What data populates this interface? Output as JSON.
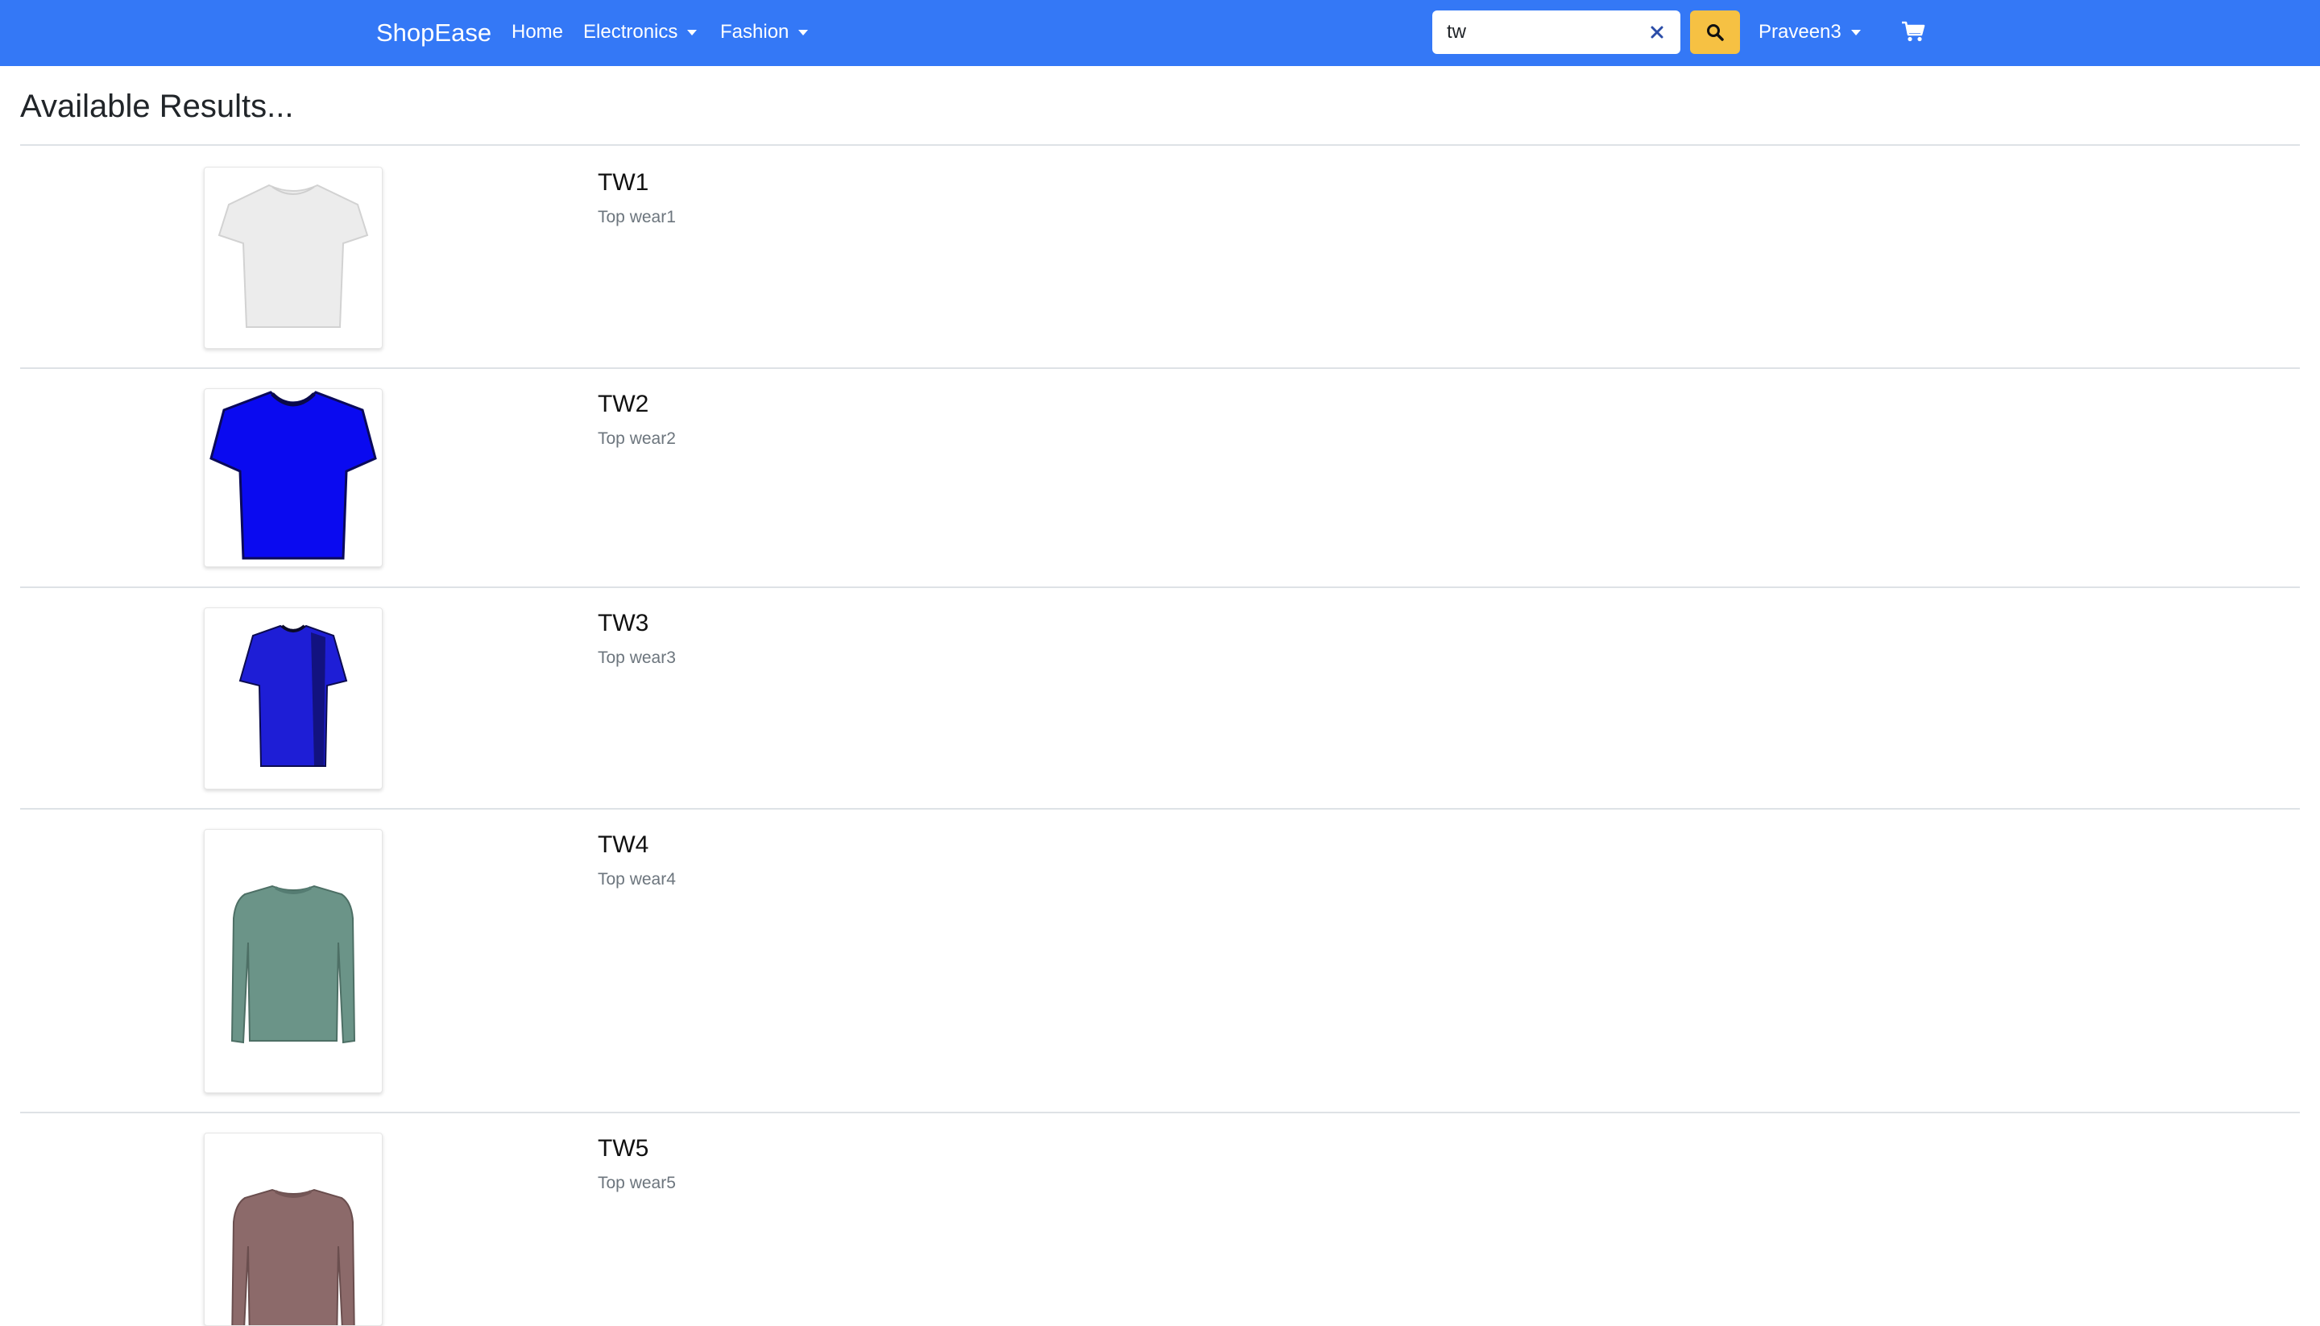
{
  "navbar": {
    "brand": "ShopEase",
    "links": [
      {
        "label": "Home",
        "dropdown": false
      },
      {
        "label": "Electronics",
        "dropdown": true
      },
      {
        "label": "Fashion",
        "dropdown": true
      }
    ],
    "search": {
      "value": "tw"
    },
    "user": {
      "label": "Praveen3"
    },
    "icons": {
      "clear": "close-icon",
      "search": "search-icon",
      "cart": "cart-icon"
    },
    "colors": {
      "navbar": "#3478f6",
      "search_button": "#f6c143"
    }
  },
  "page": {
    "heading": "Available Results..."
  },
  "results": [
    {
      "title": "TW1",
      "description": "Top wear1",
      "image": "white t-shirt",
      "color": "#ececec"
    },
    {
      "title": "TW2",
      "description": "Top wear2",
      "image": "blue t-shirt",
      "color": "#0a0af0"
    },
    {
      "title": "TW3",
      "description": "Top wear3",
      "image": "blue t-shirt",
      "color": "#1e1ed6"
    },
    {
      "title": "TW4",
      "description": "Top wear4",
      "image": "green long-sleeve sweater",
      "color": "#6b9488"
    },
    {
      "title": "TW5",
      "description": "Top wear5",
      "image": "mauve long-sleeve sweater",
      "color": "#8c6a6a"
    }
  ]
}
